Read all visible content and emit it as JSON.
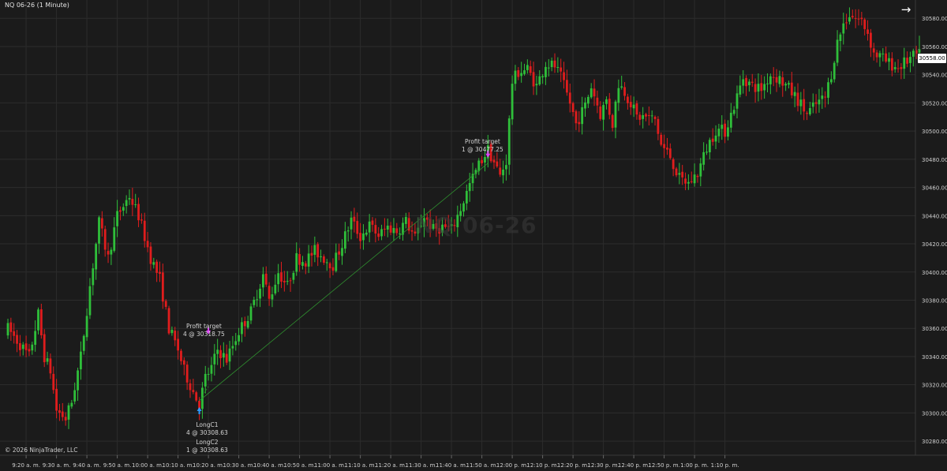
{
  "instrument_label": "NQ 06-26 (1 Minute)",
  "watermark": "NQ 06-26",
  "copyright": "© 2026 NinjaTrader, LLC",
  "current_price": "30558.00",
  "colors": {
    "background": "#1b1b1b",
    "up_candle": "#2fbf3a",
    "down_candle": "#e01d1d",
    "grid": "#2c2c2c",
    "price_tag": "#ffffff",
    "profit_marker": "#e040fb",
    "entry_marker": "#2e9bff",
    "trade_line": "#2f8f2f"
  },
  "annotations": {
    "profit1_title": "Profit target",
    "profit1_detail": "4 @ 30318.75",
    "profit2_title": "Profit target",
    "profit2_detail": "1 @ 30477.25",
    "long1_title": "LongC1",
    "long1_detail": "4 @ 30308.63",
    "long2_title": "LongC2",
    "long2_detail": "1 @ 30308.63"
  },
  "chart_data": {
    "type": "candlestick",
    "title": "NQ 06-26 (1 Minute)",
    "y_axis": {
      "ticks": [
        "30280.00",
        "30300.00",
        "30320.00",
        "30340.00",
        "30360.00",
        "30380.00",
        "30400.00",
        "30420.00",
        "30440.00",
        "30460.00",
        "30480.00",
        "30500.00",
        "30520.00",
        "30540.00",
        "30560.00",
        "30580.00"
      ],
      "range": [
        30270,
        30593
      ]
    },
    "x_axis": {
      "ticks": [
        "9:20 a. m.",
        "9:30 a. m.",
        "9:40 a. m.",
        "9:50 a. m.",
        "10:00 a. m.",
        "10:10 a. m.",
        "10:20 a. m.",
        "10:30 a. m.",
        "10:40 a. m.",
        "10:50 a. m.",
        "11:00 a. m.",
        "11:10 a. m.",
        "11:20 a. m.",
        "11:30 a. m.",
        "11:40 a. m.",
        "11:50 a. m.",
        "12:00 p. m.",
        "12:10 p. m.",
        "12:20 p. m.",
        "12:30 p. m.",
        "12:40 p. m.",
        "12:50 p. m.",
        "1:00 p. m.",
        "1:10 p. m."
      ],
      "start_time": "9:14",
      "bar_minutes": 1
    },
    "grid": true,
    "last_price": 30558.0,
    "key_points": [
      [
        0,
        30360
      ],
      [
        7,
        30340
      ],
      [
        10,
        30370
      ],
      [
        12,
        30340
      ],
      [
        14,
        30330
      ],
      [
        16,
        30302
      ],
      [
        19,
        30296
      ],
      [
        21,
        30308
      ],
      [
        24,
        30340
      ],
      [
        27,
        30390
      ],
      [
        30,
        30435
      ],
      [
        33,
        30410
      ],
      [
        36,
        30440
      ],
      [
        40,
        30454
      ],
      [
        43,
        30440
      ],
      [
        47,
        30410
      ],
      [
        50,
        30395
      ],
      [
        53,
        30360
      ],
      [
        56,
        30345
      ],
      [
        58,
        30330
      ],
      [
        61,
        30315
      ],
      [
        63,
        30306
      ],
      [
        65,
        30325
      ],
      [
        67,
        30332
      ],
      [
        69,
        30345
      ],
      [
        72,
        30338
      ],
      [
        76,
        30358
      ],
      [
        80,
        30372
      ],
      [
        84,
        30398
      ],
      [
        86,
        30380
      ],
      [
        89,
        30400
      ],
      [
        92,
        30390
      ],
      [
        95,
        30410
      ],
      [
        98,
        30408
      ],
      [
        101,
        30415
      ],
      [
        104,
        30410
      ],
      [
        107,
        30405
      ],
      [
        110,
        30420
      ],
      [
        113,
        30437
      ],
      [
        116,
        30425
      ],
      [
        119,
        30433
      ],
      [
        122,
        30426
      ],
      [
        125,
        30432
      ],
      [
        128,
        30429
      ],
      [
        131,
        30436
      ],
      [
        134,
        30424
      ],
      [
        137,
        30440
      ],
      [
        140,
        30430
      ],
      [
        143,
        30432
      ],
      [
        146,
        30430
      ],
      [
        149,
        30445
      ],
      [
        152,
        30462
      ],
      [
        155,
        30476
      ],
      [
        158,
        30487
      ],
      [
        160,
        30478
      ],
      [
        162,
        30468
      ],
      [
        164,
        30479
      ],
      [
        166,
        30535
      ],
      [
        168,
        30542
      ],
      [
        171,
        30544
      ],
      [
        174,
        30532
      ],
      [
        177,
        30548
      ],
      [
        180,
        30546
      ],
      [
        182,
        30538
      ],
      [
        185,
        30520
      ],
      [
        187,
        30505
      ],
      [
        190,
        30518
      ],
      [
        192,
        30532
      ],
      [
        195,
        30512
      ],
      [
        197,
        30522
      ],
      [
        199,
        30505
      ],
      [
        201,
        30534
      ],
      [
        203,
        30528
      ],
      [
        205,
        30520
      ],
      [
        207,
        30510
      ],
      [
        210,
        30510
      ],
      [
        213,
        30508
      ],
      [
        215,
        30490
      ],
      [
        218,
        30482
      ],
      [
        221,
        30466
      ],
      [
        224,
        30463
      ],
      [
        227,
        30470
      ],
      [
        230,
        30488
      ],
      [
        233,
        30501
      ],
      [
        236,
        30500
      ],
      [
        239,
        30518
      ],
      [
        242,
        30538
      ],
      [
        245,
        30532
      ],
      [
        248,
        30530
      ],
      [
        251,
        30540
      ],
      [
        254,
        30537
      ],
      [
        257,
        30530
      ],
      [
        260,
        30522
      ],
      [
        263,
        30512
      ],
      [
        266,
        30519
      ],
      [
        269,
        30524
      ],
      [
        271,
        30541
      ],
      [
        273,
        30563
      ],
      [
        275,
        30576
      ],
      [
        277,
        30583
      ],
      [
        279,
        30580
      ],
      [
        281,
        30578
      ],
      [
        283,
        30570
      ],
      [
        285,
        30555
      ],
      [
        287,
        30553
      ],
      [
        290,
        30548
      ],
      [
        293,
        30545
      ],
      [
        296,
        30550
      ],
      [
        299,
        30554
      ],
      [
        300,
        30558
      ]
    ],
    "annotations": [
      {
        "type": "profit_target",
        "label": "Profit target",
        "detail": "4 @ 30318.75"
      },
      {
        "type": "profit_target",
        "label": "Profit target",
        "detail": "1 @ 30477.25"
      },
      {
        "type": "entry",
        "label": "LongC1",
        "detail": "4 @ 30308.63"
      },
      {
        "type": "entry",
        "label": "LongC2",
        "detail": "1 @ 30308.63"
      }
    ]
  }
}
